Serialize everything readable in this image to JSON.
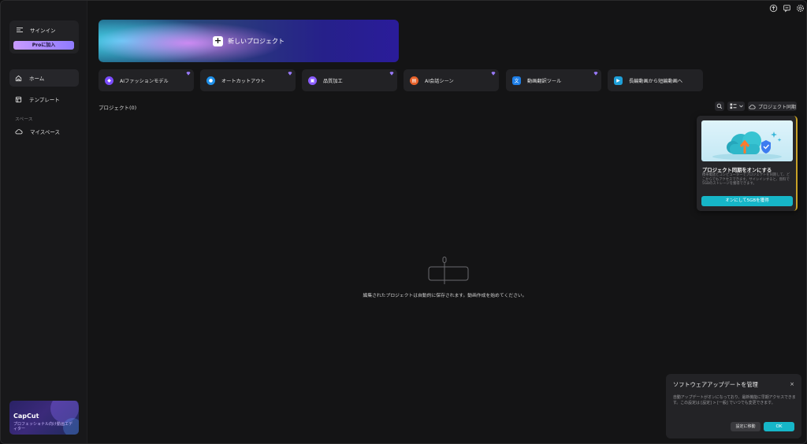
{
  "sidebar": {
    "signin_label": "サインイン",
    "pro_button": "Proに加入",
    "nav": [
      {
        "label": "ホーム"
      },
      {
        "label": "テンプレート"
      }
    ],
    "section_label": "スペース",
    "my_space": "マイスペース",
    "promo": {
      "title": "CapCut",
      "subtitle": "プロフェッショナル向け動画エディター"
    }
  },
  "hero": {
    "label": "新しいプロジェクト"
  },
  "tools": [
    {
      "label": "AIファッションモデル",
      "icon": "shirt-icon",
      "color": "#7b4cff"
    },
    {
      "label": "オートカットアウト",
      "icon": "person-cutout-icon",
      "color": "#1e8fe8"
    },
    {
      "label": "品質加工",
      "icon": "enhance-icon",
      "color": "#8a5cff"
    },
    {
      "label": "AI会話シーン",
      "icon": "chat-scene-icon",
      "color": "#e8622a"
    },
    {
      "label": "動画翻訳ツール",
      "icon": "translate-icon",
      "color": "#1e7fe8"
    },
    {
      "label": "長編動画から短編動画へ",
      "icon": "long-to-short-icon",
      "color": "#1e9fd8"
    }
  ],
  "projects": {
    "title": "プロジェクト(0)",
    "sync_label": "プロジェクト同期",
    "empty_message": "編集されたプロジェクトは自動的に保存されます。動画作成を始めてください。"
  },
  "popup": {
    "title": "プロジェクト同期をオンにする",
    "body": "携帯電話とコンピューターでプロジェクトを同期して、どこからでもアクセスできます。サインインすると、無料で5GBのストレージを獲得できます。",
    "button": "オンにして5GBを獲得"
  },
  "toast": {
    "title": "ソフトウェアアップデートを管理",
    "body": "自動アップデートがオンになっており、最新機能に早期アクセスできます。この設定は [設定] > [一般] でいつでも変更できます。",
    "settings_button": "設定に移動",
    "ok_button": "OK",
    "close": "×"
  },
  "colors": {
    "accent": "#16b6c8",
    "pro_gradient_start": "#c89bff",
    "gem": "#9b7bff"
  }
}
